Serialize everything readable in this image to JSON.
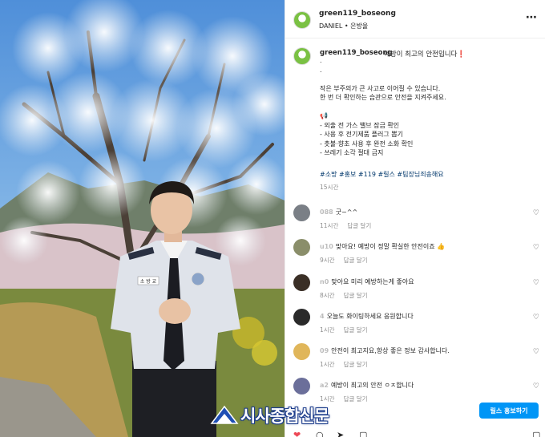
{
  "header": {
    "username": "green119_boseong",
    "subtitle": "DANIEL • 은방울",
    "more_icon": "⋯"
  },
  "caption": {
    "username": "green119_boseong",
    "title": "예방이 최고의 안전입니다❗",
    "lines": ".\n.\n\n작은 부주의가 큰 사고로 이어질 수 있습니다.\n한 번 더 확인하는 습관으로 안전을 지켜주세요.\n\n📢\n- 외출 전 가스 밸브 잠금 확인\n- 사용 후 전기제품 플러그 뽑기\n- 촛불·향초 사용 후 완전 소화 확인\n- 쓰레기 소각 절대 금지",
    "hashtags": "#소방 #홍보 #119 #릴스 #팀장님죄송해요",
    "time": "15시간"
  },
  "comments": [
    {
      "user": "088",
      "text": "굿~^^",
      "time": "11시간",
      "reply": "답글 달기"
    },
    {
      "user": "u10",
      "text": "맞아요! 예방이 정말 확실한 안전이죠 👍",
      "time": "9시간",
      "reply": "답글 달기"
    },
    {
      "user": "n0",
      "text": "맞아요 미리 예방하는게 좋아요",
      "time": "8시간",
      "reply": "답글 달기"
    },
    {
      "user": "4",
      "text": "오늘도 화이팅하세요 응원합니다",
      "time": "1시간",
      "reply": "답글 달기"
    },
    {
      "user": "09",
      "text": "안전이 최고지요,항상 좋은 정보 감사합니다.",
      "time": "1시간",
      "reply": "답글 달기"
    },
    {
      "user": "a2",
      "text": "예방이 최고의 안전 ㅇㅈ합니다",
      "time": "1시간",
      "reply": "답글 달기"
    }
  ],
  "reels_button": "릴스 홍보하기",
  "watermark": "시사종합신문",
  "photo": {
    "badge_text": "소 방 교"
  },
  "colors": {
    "link": "#00376b",
    "button": "#0095f6",
    "muted": "#8e8e8e"
  },
  "icons": {
    "heart": "♡",
    "heart_filled": "❤",
    "comment": "○",
    "share": "➤",
    "bookmark": "▢"
  }
}
